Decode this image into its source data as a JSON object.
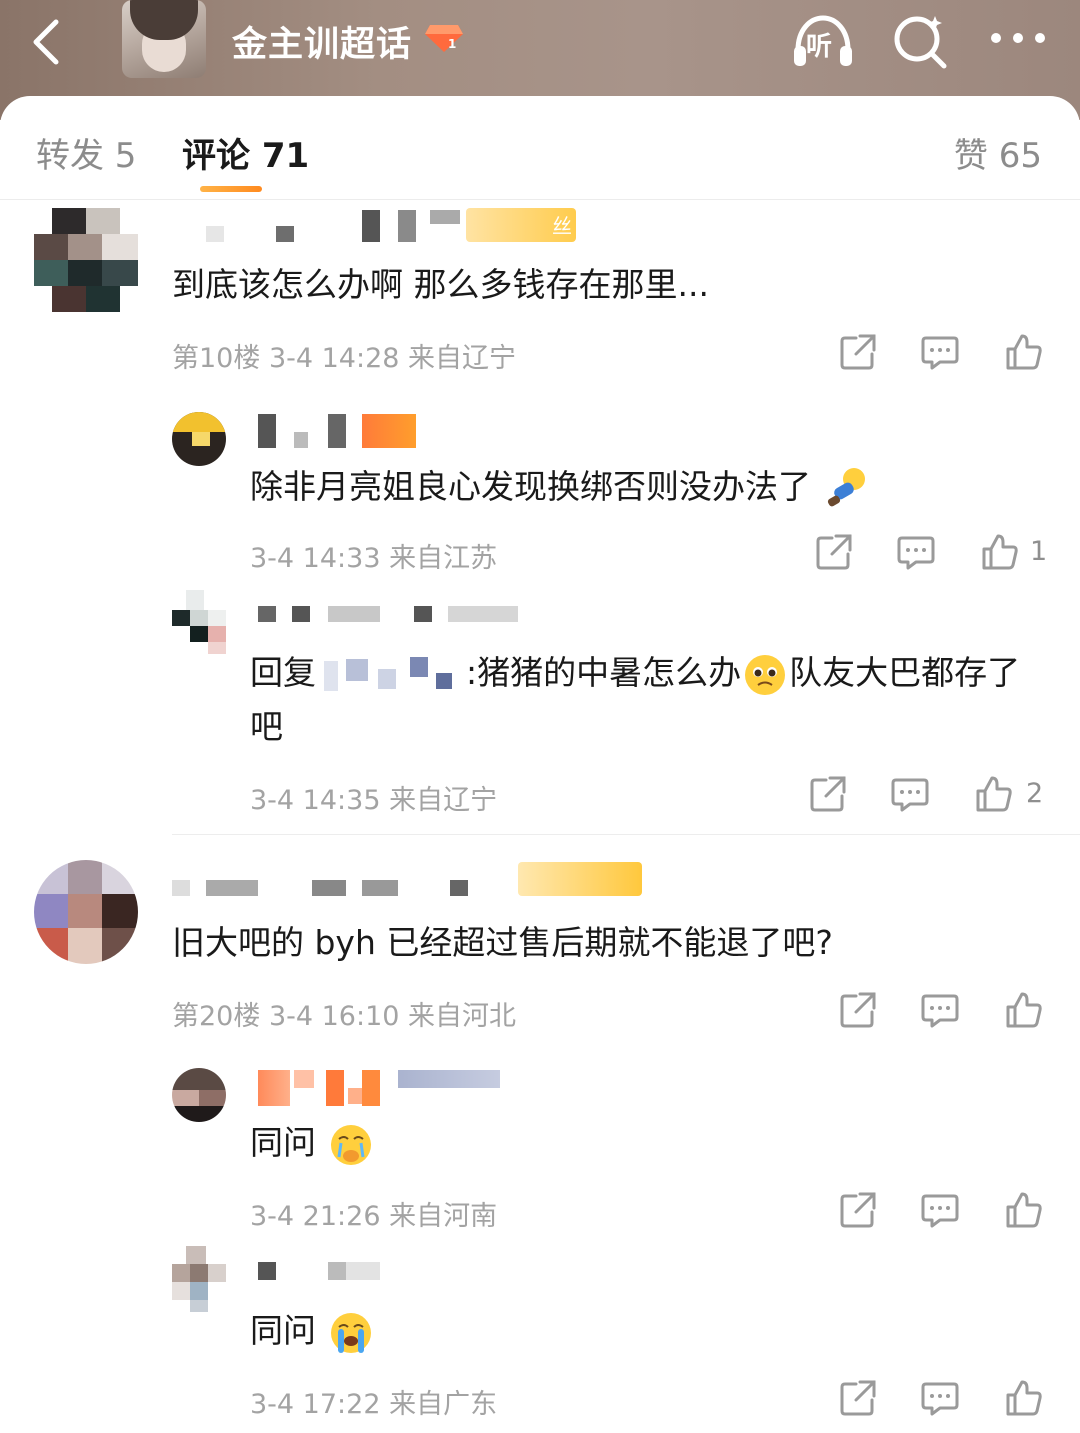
{
  "header": {
    "title": "金主训超话",
    "listen_label": "听"
  },
  "tabs": [
    {
      "label": "转发 5"
    },
    {
      "label": "评论 71"
    },
    {
      "label": "赞 65"
    }
  ],
  "fan_badge_text": "丝",
  "comments": [
    {
      "text": "到底该怎么办啊 那么多钱存在那里...",
      "meta": "第10楼 3-4 14:28 来自辽宁",
      "likes": "",
      "replies": [
        {
          "text": "除非月亮姐良心发现换绑否则没办法了",
          "meta": "3-4 14:33 来自江苏",
          "likes": "1"
        },
        {
          "text_prefix": "回复",
          "text_mid": ":猪猪的中暑怎么办",
          "text_suffix": "队友大巴都存了吧",
          "meta": "3-4 14:35 来自辽宁",
          "likes": "2"
        }
      ]
    },
    {
      "text": "旧大吧的 byh 已经超过售后期就不能退了吧?",
      "meta": "第20楼 3-4 16:10 来自河北",
      "likes": "",
      "replies": [
        {
          "text": "同问",
          "meta": "3-4 21:26 来自河南",
          "likes": ""
        },
        {
          "text": "同问",
          "meta": "3-4 17:22 来自广东",
          "likes": ""
        }
      ]
    }
  ],
  "colors": {
    "accent": "#ff8a1f",
    "meta_gray": "#a3a3a3",
    "text": "#1a1a1a"
  }
}
